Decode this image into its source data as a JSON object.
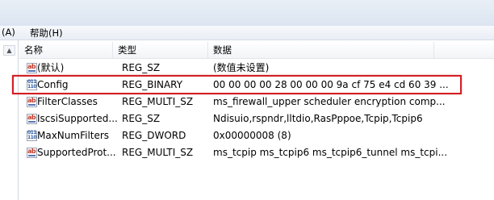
{
  "menubar": {
    "partial_menu": "(A)",
    "help_menu": "帮助(H)"
  },
  "tree": {
    "scroll_up_glyph": "▲"
  },
  "columns": {
    "name": "名称",
    "type": "类型",
    "data": "数据"
  },
  "rows": [
    {
      "icon": "string-value-icon",
      "name": "(默认)",
      "type": "REG_SZ",
      "data": "(数值未设置)"
    },
    {
      "icon": "binary-value-icon",
      "name": "Config",
      "type": "REG_BINARY",
      "data": "00 00 00 00 28 00 00 00 9a cf 75 e4 cd 60 39 ..."
    },
    {
      "icon": "string-value-icon",
      "name": "FilterClasses",
      "type": "REG_MULTI_SZ",
      "data": "ms_firewall_upper scheduler encryption comp..."
    },
    {
      "icon": "string-value-icon",
      "name": "IscsiSupported...",
      "type": "REG_SZ",
      "data": "Ndisuio,rspndr,lltdio,RasPppoe,Tcpip,Tcpip6"
    },
    {
      "icon": "binary-value-icon",
      "name": "MaxNumFilters",
      "type": "REG_DWORD",
      "data": "0x00000008 (8)"
    },
    {
      "icon": "string-value-icon",
      "name": "SupportedProt...",
      "type": "REG_MULTI_SZ",
      "data": "ms_tcpip ms_tcpip6 ms_tcpip6_tunnel ms_tcpi..."
    }
  ],
  "highlight_color": "#d31f26"
}
